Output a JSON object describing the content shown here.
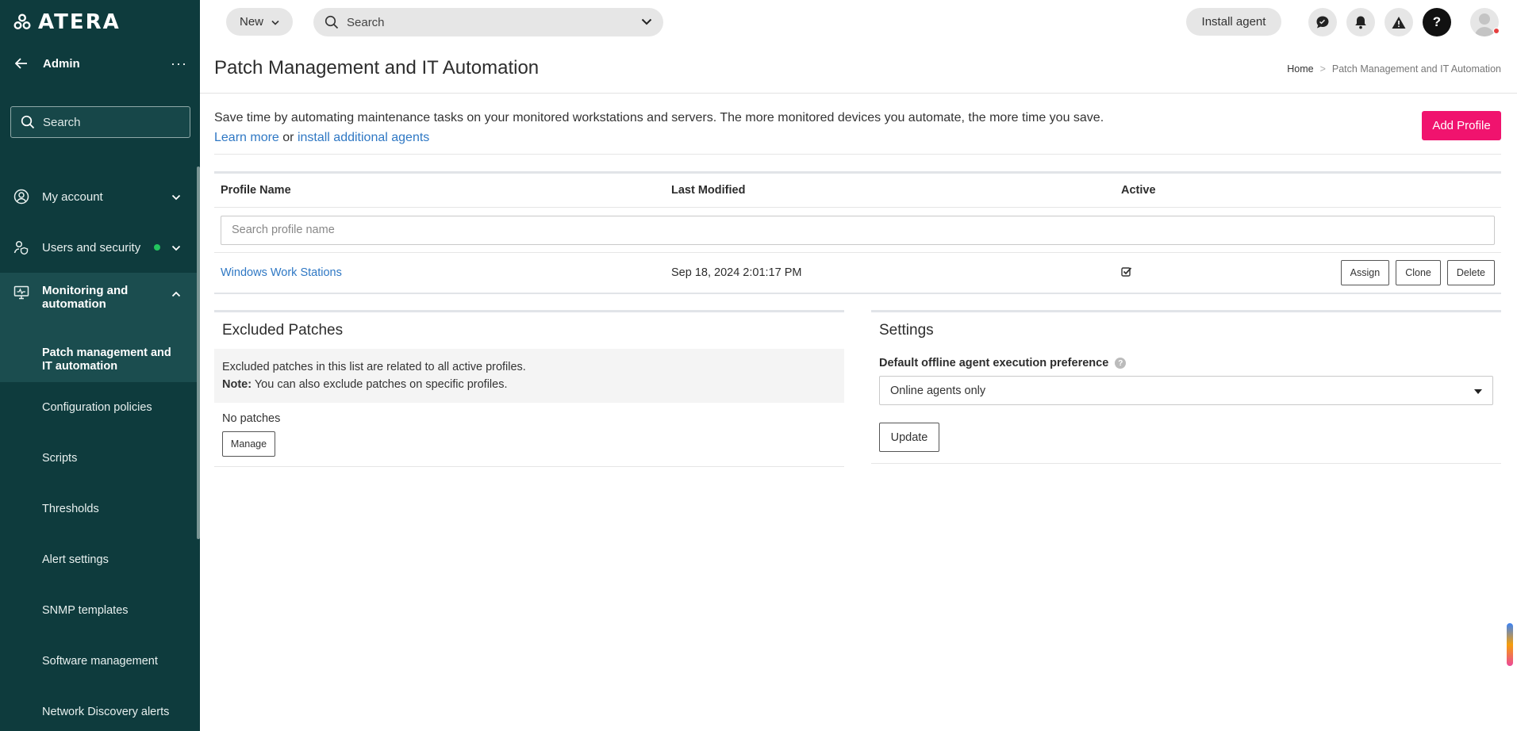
{
  "brand": {
    "wordmark": "ATERA"
  },
  "sidebar": {
    "admin_title": "Admin",
    "more_label": "···",
    "search_placeholder": "Search",
    "items": [
      {
        "label": "My account",
        "icon": "user-circle-icon"
      },
      {
        "label": "Users and security",
        "icon": "users-security-icon",
        "status_color": "#22c55e"
      },
      {
        "label": "Monitoring and automation",
        "icon": "monitor-icon"
      }
    ],
    "sub_items": [
      {
        "label": "Patch management and IT automation"
      },
      {
        "label": "Configuration policies"
      },
      {
        "label": "Scripts"
      },
      {
        "label": "Thresholds"
      },
      {
        "label": "Alert settings"
      },
      {
        "label": "SNMP templates"
      },
      {
        "label": "Software management"
      },
      {
        "label": "Network Discovery alerts"
      }
    ]
  },
  "topbar": {
    "new_label": "New",
    "search_placeholder": "Search",
    "install_label": "Install agent",
    "help_label": "?"
  },
  "page": {
    "title": "Patch Management and IT Automation",
    "breadcrumb": {
      "home": "Home",
      "sep": ">",
      "current": "Patch Management and IT Automation"
    },
    "intro_text": "Save time by automating maintenance tasks on your monitored workstations and servers. The more monitored devices you automate, the more time you save.",
    "learn_more": "Learn more",
    "or_text": " or ",
    "install_link": "install additional agents",
    "add_profile": "Add Profile"
  },
  "profiles": {
    "headers": [
      "Profile Name",
      "Last Modified",
      "Active"
    ],
    "search_placeholder": "Search profile name",
    "rows": [
      {
        "name": "Windows Work Stations",
        "modified": "Sep 18, 2024 2:01:17 PM",
        "active": true
      }
    ],
    "actions": {
      "assign": "Assign",
      "clone": "Clone",
      "delete": "Delete"
    }
  },
  "excluded": {
    "title": "Excluded Patches",
    "info": "Excluded patches in this list are related to all active profiles.",
    "note_label": "Note:",
    "note_text": " You can also exclude patches on specific profiles.",
    "empty": "No patches",
    "manage": "Manage"
  },
  "settings": {
    "title": "Settings",
    "label": "Default offline agent execution preference",
    "selected": "Online agents only",
    "update": "Update"
  },
  "colors": {
    "sidebar_bg": "#0e3b3d",
    "accent": "#f0136e",
    "link": "#2f78c4"
  }
}
